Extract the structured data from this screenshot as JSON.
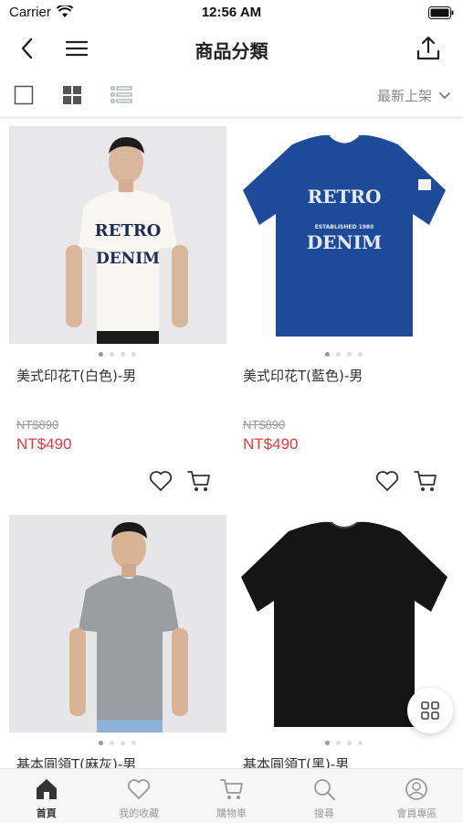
{
  "status_bar": {
    "carrier": "Carrier",
    "time": "12:56 AM"
  },
  "nav": {
    "title": "商品分類"
  },
  "toolbar": {
    "sort_label": "最新上架"
  },
  "products": [
    {
      "name": "美式印花T(白色)-男",
      "old_price": "NT$890",
      "price": "NT$490",
      "image_colors": {
        "bg": "#e8e8ea",
        "shirt": "#f7f5f0",
        "print": "#1f2a55"
      }
    },
    {
      "name": "美式印花T(藍色)-男",
      "old_price": "NT$890",
      "price": "NT$490",
      "image_colors": {
        "bg": "#ffffff",
        "shirt": "#1d4b9a",
        "print": "#e6eaf5"
      }
    },
    {
      "name": "基本圓領T(麻灰)-男",
      "image_colors": {
        "bg": "#e6e6e8",
        "shirt": "#9a9da1"
      }
    },
    {
      "name": "基本圓領T(黑)-男",
      "image_colors": {
        "bg": "#ffffff",
        "shirt": "#151515"
      }
    }
  ],
  "tabs": [
    {
      "label": "首頁",
      "icon": "home-icon",
      "active": true
    },
    {
      "label": "我的收藏",
      "icon": "heart-icon",
      "active": false
    },
    {
      "label": "購物車",
      "icon": "cart-icon",
      "active": false
    },
    {
      "label": "搜尋",
      "icon": "search-icon",
      "active": false
    },
    {
      "label": "會員專區",
      "icon": "user-icon",
      "active": false
    }
  ],
  "colors": {
    "price_red": "#e8383d",
    "accent_text": "#222222"
  }
}
